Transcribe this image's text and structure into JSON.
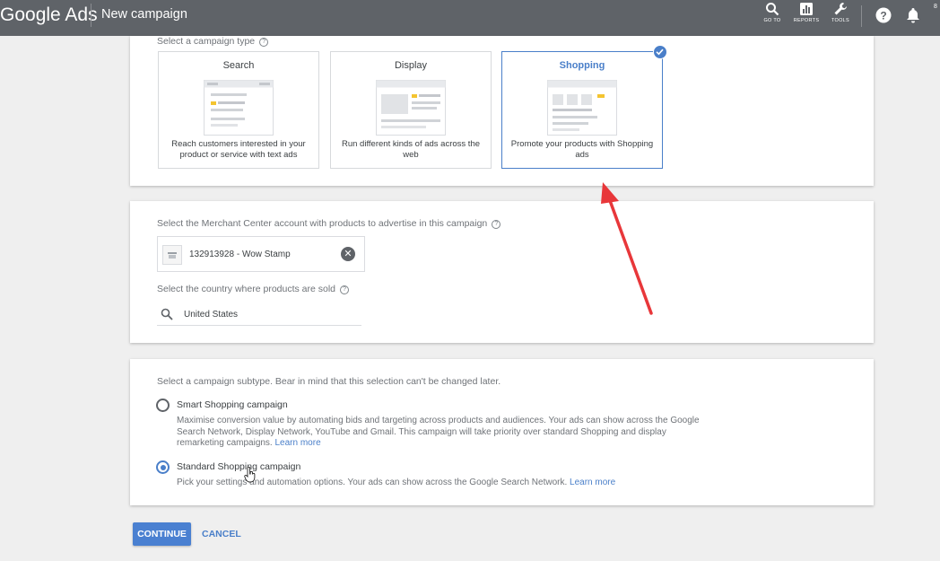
{
  "topbar": {
    "brand": "Google Ads",
    "page_title": "New campaign",
    "goto_label": "GO TO",
    "reports_label": "REPORTS",
    "tools_label": "TOOLS",
    "account_digit": "8"
  },
  "campaign_type": {
    "label": "Select a campaign type",
    "tiles": [
      {
        "title": "Search",
        "desc": "Reach customers interested in your product or service with text ads",
        "selected": false
      },
      {
        "title": "Display",
        "desc": "Run different kinds of ads across the web",
        "selected": false
      },
      {
        "title": "Shopping",
        "desc": "Promote your products with Shopping ads",
        "selected": true
      }
    ]
  },
  "merchant": {
    "label": "Select the Merchant Center account with products to advertise in this campaign",
    "account": "132913928 - Wow Stamp",
    "country_label": "Select the country where products are sold",
    "country_value": "United States"
  },
  "subtype": {
    "label": "Select a campaign subtype. Bear in mind that this selection can't be changed later.",
    "options": [
      {
        "title": "Smart Shopping campaign",
        "desc": "Maximise conversion value by automating bids and targeting across products and audiences. Your ads can show across the Google Search Network, Display Network, YouTube and Gmail. This campaign will take priority over standard Shopping and display remarketing campaigns.",
        "link": "Learn more",
        "selected": false
      },
      {
        "title": "Standard Shopping campaign",
        "desc": "Pick your settings and automation options. Your ads can show across the Google Search Network.",
        "link": "Learn more",
        "selected": true
      }
    ]
  },
  "actions": {
    "continue": "CONTINUE",
    "cancel": "CANCEL"
  },
  "colors": {
    "accent": "#4a7fc9",
    "topbar": "#5f6368",
    "annotation_arrow": "#e8373a"
  }
}
